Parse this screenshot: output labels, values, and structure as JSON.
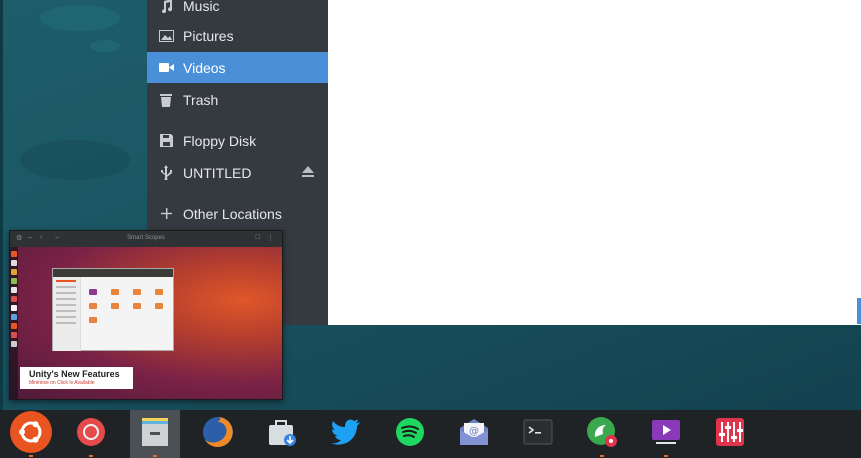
{
  "sidebar": {
    "items": [
      {
        "label": "Music",
        "icon": "music-icon"
      },
      {
        "label": "Pictures",
        "icon": "pictures-icon"
      },
      {
        "label": "Videos",
        "icon": "videos-icon",
        "active": true
      },
      {
        "label": "Trash",
        "icon": "trash-icon"
      },
      {
        "label": "Floppy Disk",
        "icon": "floppy-disk-icon"
      },
      {
        "label": "UNTITLED",
        "icon": "usb-icon"
      },
      {
        "label": "Other Locations",
        "icon": "plus-icon"
      }
    ]
  },
  "preview": {
    "window_title": "Smart Scopes",
    "card_heading": "Unity's New Features",
    "card_subtext": "Minimise on Click Is Available"
  },
  "dock": {
    "items": [
      {
        "name": "ubuntu-logo-icon",
        "color": "#e95420"
      },
      {
        "name": "chromium-icon",
        "color": "#e54b4b"
      },
      {
        "name": "files-icon",
        "color": "#f5d65b",
        "active": true
      },
      {
        "name": "firefox-icon",
        "color": "#f08a24"
      },
      {
        "name": "software-center-icon",
        "color": "#d8dde2"
      },
      {
        "name": "twitter-icon",
        "color": "#1da1f2"
      },
      {
        "name": "spotify-icon",
        "color": "#1ed760"
      },
      {
        "name": "mail-icon",
        "color": "#6a7fc4"
      },
      {
        "name": "terminal-icon",
        "color": "#2b2e31"
      },
      {
        "name": "settings-app-icon",
        "color": "#3aa84e"
      },
      {
        "name": "video-player-icon",
        "color": "#8a3ab9"
      },
      {
        "name": "mixer-icon",
        "color": "#e0344c"
      }
    ]
  },
  "colors": {
    "accent": "#4a90d9",
    "dock_indicator": "#e86b2a"
  }
}
